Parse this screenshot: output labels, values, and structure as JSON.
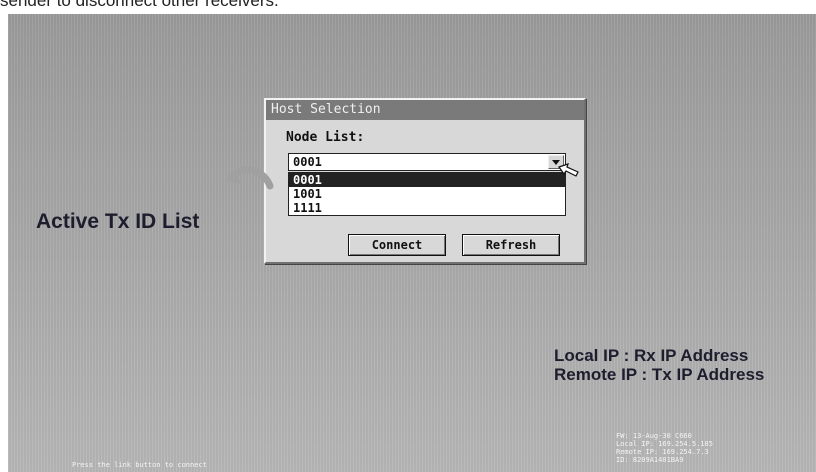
{
  "caption": "sender to disconnect other receivers.",
  "dialog": {
    "title": "Host Selection",
    "node_label": "Node List:",
    "selected_value": "0001",
    "options": [
      "0001",
      "1001",
      "1111"
    ],
    "highlighted_index": 0,
    "connect_label": "Connect",
    "refresh_label": "Refresh"
  },
  "annotations": {
    "active_list": "Active Tx ID List",
    "local_ip": "Local IP : Rx IP Address",
    "remote_ip": "Remote IP : Tx IP Address"
  },
  "status_bar": {
    "press_msg": "Press the link button to connect",
    "fw": "FW: 13-Aug-30 C660",
    "local_ip": "Local IP: 169.254.5.185",
    "remote_ip": "Remote IP: 169.254.7.3",
    "id": "ID: 8209A1401BA9"
  },
  "colors": {
    "title_bar": "#7a7a7a",
    "dialog_bg": "#d8d8d8",
    "screen_bg": "#a8a8a8",
    "annotation_text": "#1d1d2e"
  }
}
